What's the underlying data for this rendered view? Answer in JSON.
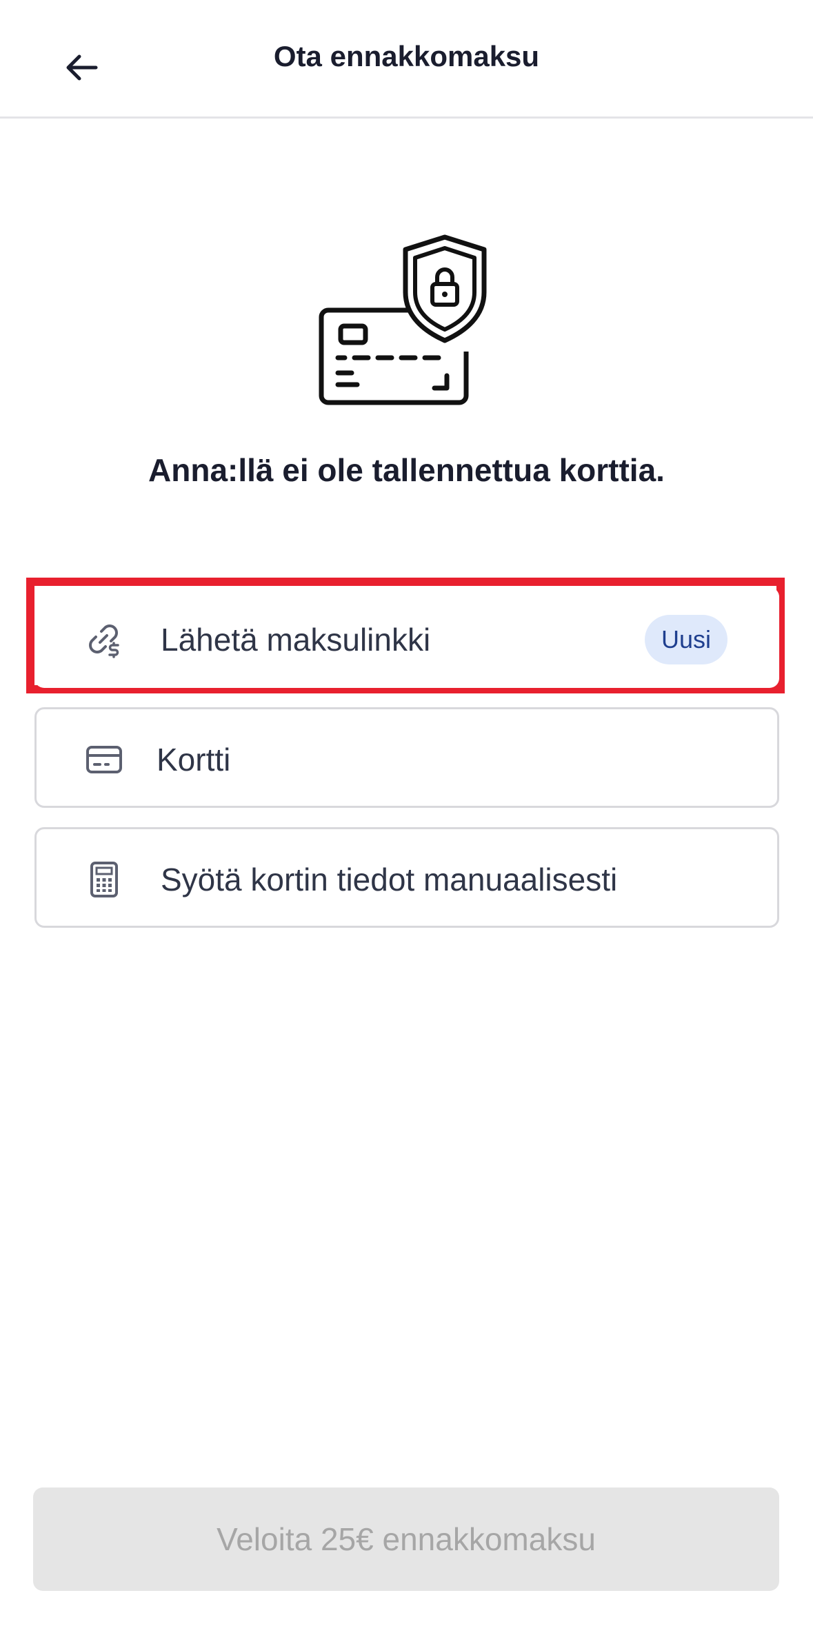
{
  "header": {
    "title": "Ota ennakkomaksu",
    "back_icon": "arrow-left-icon"
  },
  "hero": {
    "icon": "credit-card-shield-lock-icon",
    "message": "Anna:llä ei ole tallennettua korttia."
  },
  "options": [
    {
      "label": "Lähetä maksulinkki",
      "icon": "link-dollar-icon",
      "badge": "Uusi",
      "highlighted": true
    },
    {
      "label": "Kortti",
      "icon": "credit-card-icon"
    },
    {
      "label": "Syötä kortin tiedot manuaalisesti",
      "icon": "calculator-icon"
    }
  ],
  "colors": {
    "highlight": "#e8202e",
    "badge_bg": "#dfe9fb",
    "badge_text": "#1f3f8f",
    "disabled_button_bg": "#e5e5e5",
    "disabled_button_text": "#a6a6a6"
  },
  "footer": {
    "charge_button": "Veloita 25€ ennakkomaksu",
    "charge_button_state": "disabled"
  }
}
